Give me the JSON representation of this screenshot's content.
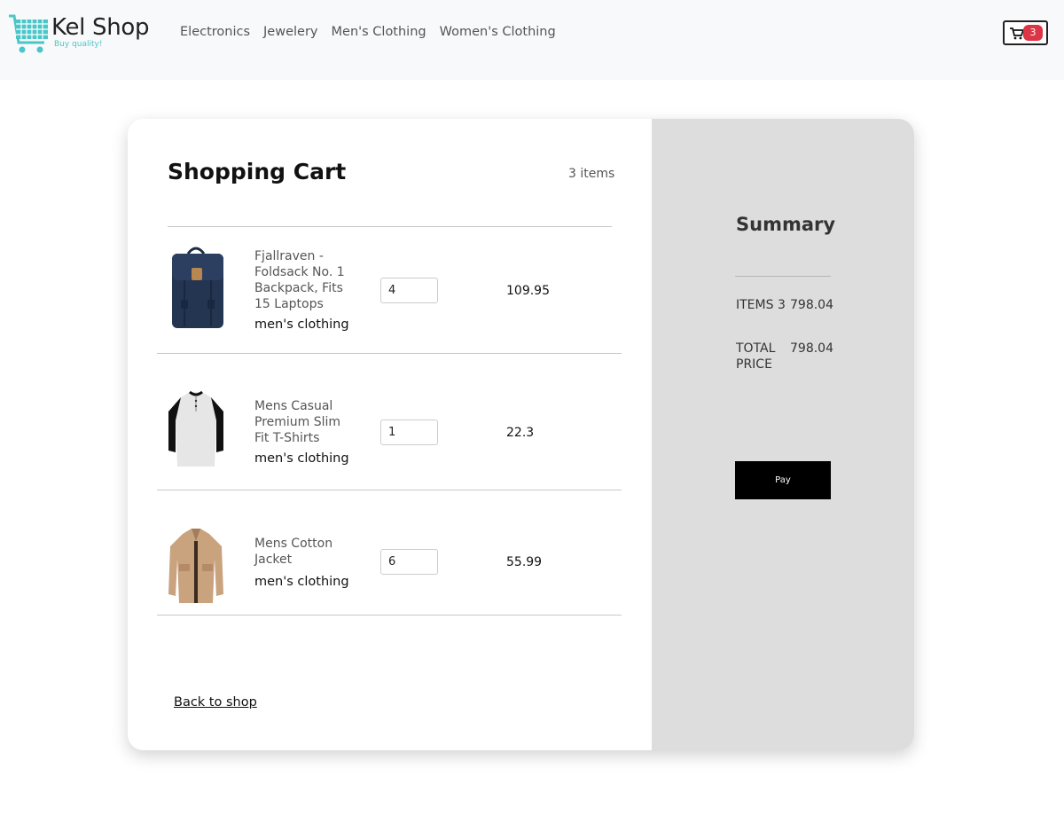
{
  "navbar": {
    "brand_name": "Kel Shop",
    "brand_tagline": "Buy quality!",
    "links": [
      "Electronics",
      "Jewelery",
      "Men's Clothing",
      "Women's Clothing"
    ],
    "cart_count": "3",
    "accent_color": "#4ac6c9",
    "badge_color": "#dc3545"
  },
  "cart": {
    "title": "Shopping Cart",
    "count_label": "3 items",
    "items": [
      {
        "name": "Fjallraven - Foldsack No. 1 Backpack, Fits 15 Laptops",
        "category": "men's clothing",
        "quantity": "4",
        "price": "109.95",
        "image": "backpack"
      },
      {
        "name": "Mens Casual Premium Slim Fit T-Shirts",
        "category": "men's clothing",
        "quantity": "1",
        "price": "22.3",
        "image": "raglan-shirt"
      },
      {
        "name": "Mens Cotton Jacket",
        "category": "men's clothing",
        "quantity": "6",
        "price": "55.99",
        "image": "jacket"
      }
    ],
    "back_link": "Back to shop"
  },
  "summary": {
    "title": "Summary",
    "items_label": "ITEMS 3",
    "items_total": "798.04",
    "total_label": "TOTAL PRICE",
    "total_value": "798.04",
    "pay_label": "Pay"
  }
}
